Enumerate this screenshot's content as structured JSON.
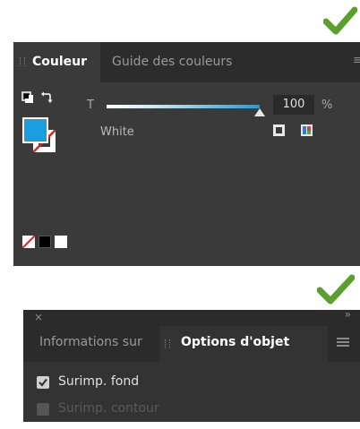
{
  "colors": {
    "checkmark": "#5aa02c",
    "panel_bg": "#3a3a3a",
    "fill": "#1a9ee0"
  },
  "color_panel": {
    "tabs": [
      {
        "label": "Couleur",
        "active": true
      },
      {
        "label": "Guide des couleurs",
        "active": false
      }
    ],
    "tint_label": "T",
    "tint_value": "100",
    "tint_fraction": 1.0,
    "tint_unit": "%",
    "swatch_name": "White",
    "icons": [
      "default-fill-stroke-icon",
      "swap-fill-stroke-icon",
      "add-swatch-icon",
      "color-picker-icon",
      "none-swatch-icon",
      "panel-menu-icon"
    ]
  },
  "attributes_panel": {
    "tabs": [
      {
        "label": "Informations sur",
        "active": false
      },
      {
        "label": "Options d'objet",
        "active": true
      }
    ],
    "close_glyph": "×",
    "collapse_glyph": "»",
    "options": [
      {
        "label": "Surimp. fond",
        "checked": true,
        "enabled": true
      },
      {
        "label": "Surimp. contour",
        "checked": false,
        "enabled": false
      }
    ]
  }
}
